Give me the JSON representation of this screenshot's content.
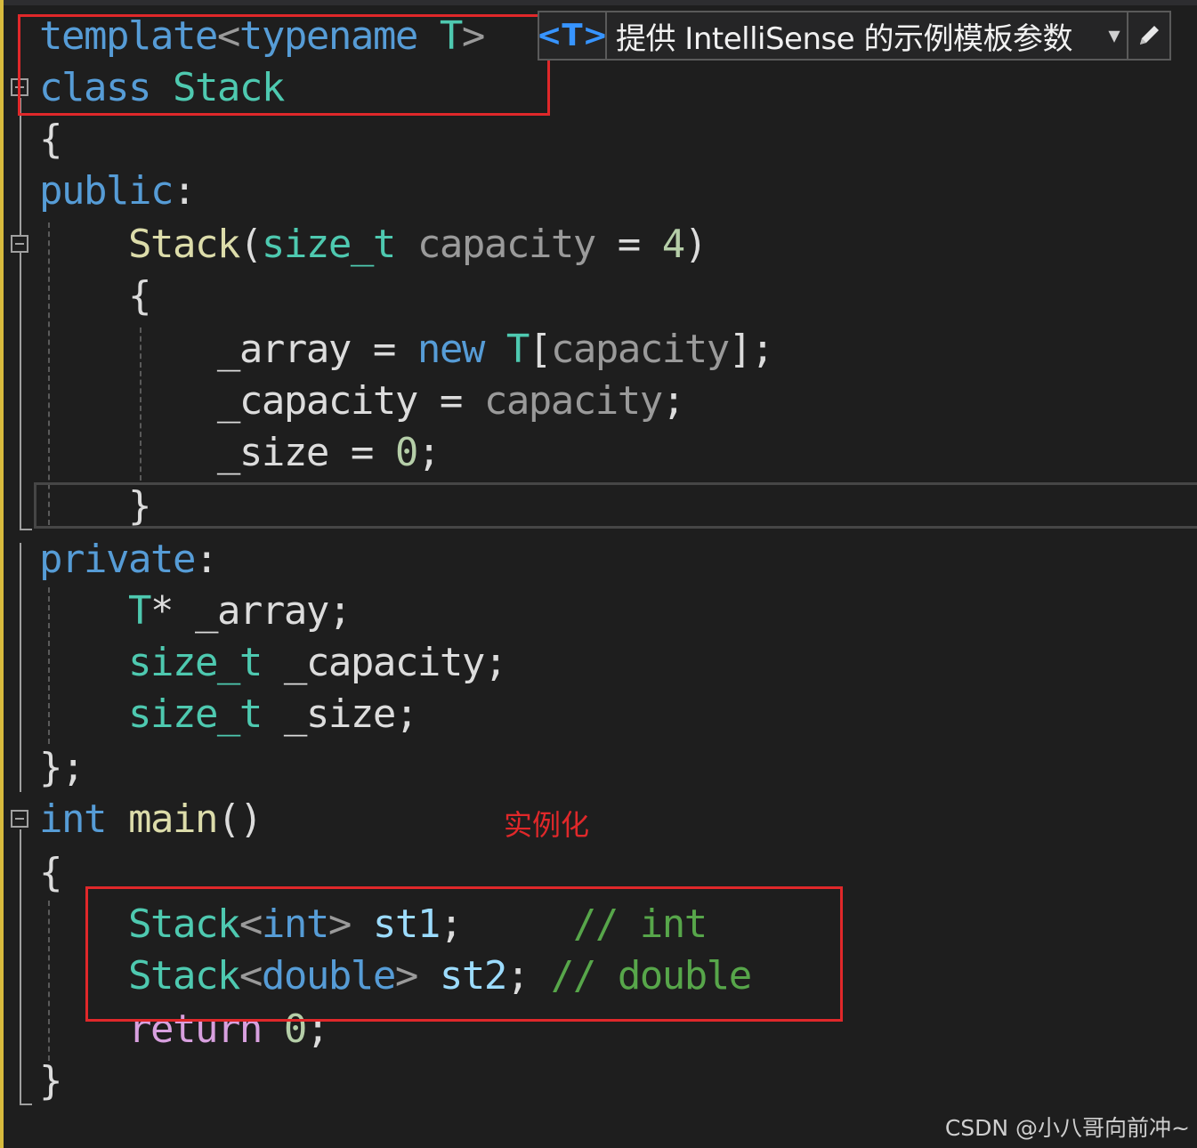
{
  "intellisense": {
    "chip": "<T>",
    "text": "提供 IntelliSense 的示例模板参数"
  },
  "code": [
    [
      [
        "template",
        "kw"
      ],
      [
        "<",
        "pa"
      ],
      [
        "typename",
        "kw"
      ],
      [
        " ",
        "pl"
      ],
      [
        "T",
        "ty"
      ],
      [
        ">",
        "pa"
      ]
    ],
    [
      [
        "class",
        "kw"
      ],
      [
        " ",
        "pl"
      ],
      [
        "Stack",
        "ty"
      ]
    ],
    [
      [
        "{",
        "pl"
      ]
    ],
    [
      [
        "public",
        "kw"
      ],
      [
        ":",
        "pl"
      ]
    ],
    [
      [
        "    ",
        "pl"
      ],
      [
        "Stack",
        "fn"
      ],
      [
        "(",
        "pl"
      ],
      [
        "size_t",
        "ty"
      ],
      [
        " ",
        "pl"
      ],
      [
        "capacity",
        "pa"
      ],
      [
        " = ",
        "pl"
      ],
      [
        "4",
        "nu"
      ],
      [
        ")",
        "pl"
      ]
    ],
    [
      [
        "    ",
        "pl"
      ],
      [
        "{",
        "pl"
      ]
    ],
    [
      [
        "        ",
        "pl"
      ],
      [
        "_array",
        "pl"
      ],
      [
        " = ",
        "pl"
      ],
      [
        "new",
        "kw"
      ],
      [
        " ",
        "pl"
      ],
      [
        "T",
        "ty"
      ],
      [
        "[",
        "pl"
      ],
      [
        "capacity",
        "pa"
      ],
      [
        "];",
        "pl"
      ]
    ],
    [
      [
        "        ",
        "pl"
      ],
      [
        "_capacity",
        "pl"
      ],
      [
        " = ",
        "pl"
      ],
      [
        "capacity",
        "pa"
      ],
      [
        ";",
        "pl"
      ]
    ],
    [
      [
        "        ",
        "pl"
      ],
      [
        "_size",
        "pl"
      ],
      [
        " = ",
        "pl"
      ],
      [
        "0",
        "nu"
      ],
      [
        ";",
        "pl"
      ]
    ],
    [
      [
        "    ",
        "pl"
      ],
      [
        "}",
        "pl"
      ]
    ],
    [
      [
        "private",
        "kw"
      ],
      [
        ":",
        "pl"
      ]
    ],
    [
      [
        "    ",
        "pl"
      ],
      [
        "T",
        "ty"
      ],
      [
        "* ",
        "pl"
      ],
      [
        "_array",
        "pl"
      ],
      [
        ";",
        "pl"
      ]
    ],
    [
      [
        "    ",
        "pl"
      ],
      [
        "size_t",
        "ty"
      ],
      [
        " ",
        "pl"
      ],
      [
        "_capacity",
        "pl"
      ],
      [
        ";",
        "pl"
      ]
    ],
    [
      [
        "    ",
        "pl"
      ],
      [
        "size_t",
        "ty"
      ],
      [
        " ",
        "pl"
      ],
      [
        "_size",
        "pl"
      ],
      [
        ";",
        "pl"
      ]
    ],
    [
      [
        "};",
        "pl"
      ]
    ],
    [
      [
        "int",
        "kw"
      ],
      [
        " ",
        "pl"
      ],
      [
        "main",
        "fn"
      ],
      [
        "()",
        "pl"
      ]
    ],
    [
      [
        "{",
        "pl"
      ]
    ],
    [
      [
        "    ",
        "pl"
      ],
      [
        "Stack",
        "ty"
      ],
      [
        "<",
        "pa"
      ],
      [
        "int",
        "kw"
      ],
      [
        "> ",
        "pa"
      ],
      [
        "st1",
        "va"
      ],
      [
        ";",
        "pl"
      ],
      [
        "     ",
        "pl"
      ],
      [
        "// int",
        "cm"
      ]
    ],
    [
      [
        "    ",
        "pl"
      ],
      [
        "Stack",
        "ty"
      ],
      [
        "<",
        "pa"
      ],
      [
        "double",
        "kw"
      ],
      [
        "> ",
        "pa"
      ],
      [
        "st2",
        "va"
      ],
      [
        ";",
        "pl"
      ],
      [
        " ",
        "pl"
      ],
      [
        "// double",
        "cm"
      ]
    ],
    [
      [
        "    ",
        "pl"
      ],
      [
        "return",
        "ct"
      ],
      [
        " ",
        "pl"
      ],
      [
        "0",
        "nu"
      ],
      [
        ";",
        "pl"
      ]
    ],
    [
      [
        "}",
        "pl"
      ]
    ]
  ],
  "annotation": "实例化",
  "watermark": "CSDN @小八哥向前冲~"
}
